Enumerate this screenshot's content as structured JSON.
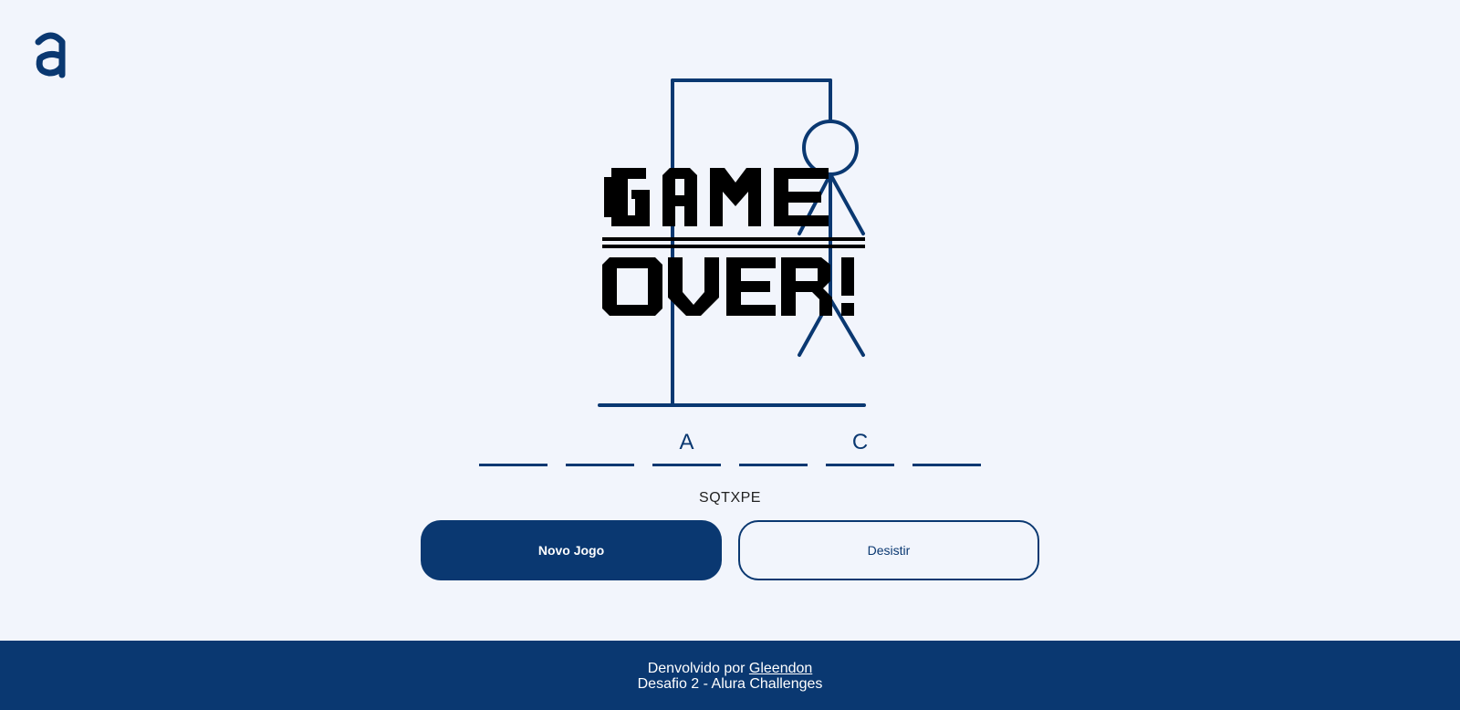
{
  "brand": {
    "logo_icon": "alura-a-logo-icon",
    "color": "#0a3871"
  },
  "game": {
    "status_banner": "GAME OVER!",
    "letters": [
      "",
      "",
      "A",
      "",
      "C",
      ""
    ],
    "wrong_letters": "SQTXPE"
  },
  "buttons": {
    "new_game": "Novo Jogo",
    "give_up": "Desistir"
  },
  "footer": {
    "developed_by": "Denvolvido por ",
    "author": "Gleendon",
    "challenge": "Desafio 2 - Alura Challenges"
  }
}
